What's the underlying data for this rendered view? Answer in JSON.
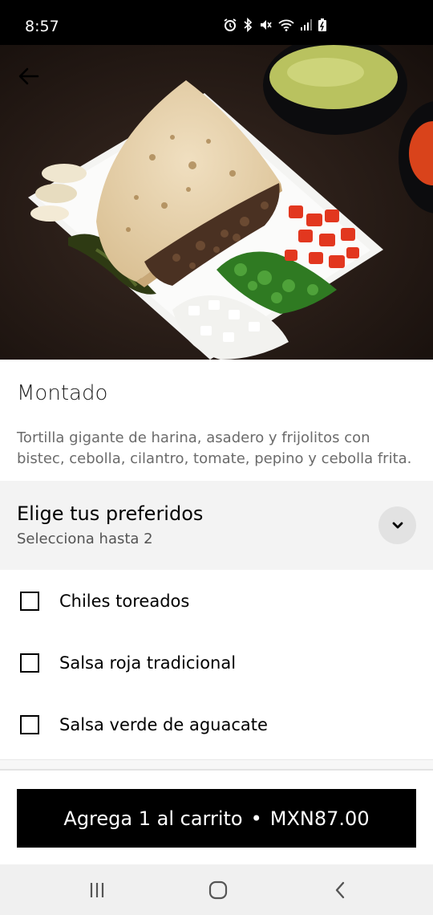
{
  "status_bar": {
    "time": "8:57",
    "icons": [
      "alarm-icon",
      "bluetooth-icon",
      "mute-icon",
      "wifi-icon",
      "signal-icon",
      "battery-icon"
    ]
  },
  "header": {
    "back_icon": "arrow-left-icon"
  },
  "item": {
    "title": "Montado",
    "description": "Tortilla gigante de harina, asadero y frijolitos con bistec, cebolla, cilantro, tomate, pepino y cebolla frita."
  },
  "options": {
    "title": "Elige tus preferidos",
    "subtitle": "Selecciona hasta 2",
    "toggle_icon": "chevron-down-icon",
    "items": [
      {
        "label": "Chiles toreados",
        "checked": false
      },
      {
        "label": "Salsa roja tradicional",
        "checked": false
      },
      {
        "label": "Salsa verde de aguacate",
        "checked": false
      }
    ]
  },
  "cart": {
    "label": "Agrega 1 al carrito",
    "separator": "•",
    "price": "MXN87.00"
  },
  "nav_bar": {
    "buttons": [
      "recents-icon",
      "home-icon",
      "back-icon"
    ]
  },
  "colors": {
    "primary": "#000000",
    "header_bg": "#f3f3f3",
    "muted_text": "#6b6b6b"
  }
}
